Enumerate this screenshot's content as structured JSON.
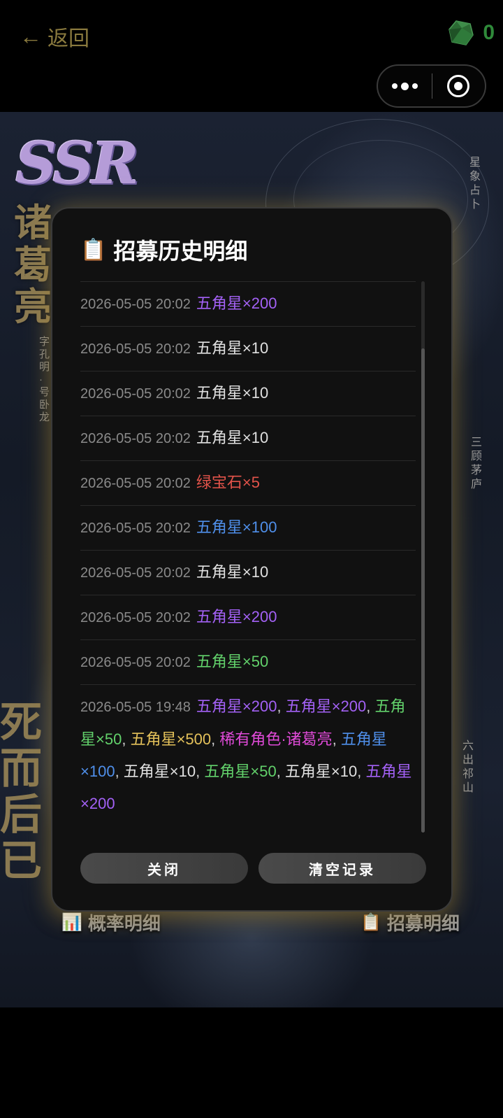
{
  "topbar": {
    "back_label": "返回",
    "gem_count": "0",
    "colors": {
      "back": "#8a7a3e",
      "gem": "#2f8a3a"
    }
  },
  "art": {
    "badge": "SSR",
    "hero_name": "诸葛亮",
    "hero_sub": "字孔明·号卧龙",
    "motto": "死而后已",
    "side_labels": [
      "星象占卜",
      "三顾茅庐",
      "六出祁山"
    ]
  },
  "modal": {
    "title": "招募历史明细",
    "title_icon": "clipboard-icon",
    "close_label": "关闭",
    "clear_label": "清空记录",
    "records": [
      {
        "time": "2026-05-05 20:02",
        "items": [
          {
            "text": "五角星×200",
            "color": "purple"
          }
        ]
      },
      {
        "time": "2026-05-05 20:02",
        "items": [
          {
            "text": "五角星×10",
            "color": "white"
          }
        ]
      },
      {
        "time": "2026-05-05 20:02",
        "items": [
          {
            "text": "五角星×10",
            "color": "white"
          }
        ]
      },
      {
        "time": "2026-05-05 20:02",
        "items": [
          {
            "text": "五角星×10",
            "color": "white"
          }
        ]
      },
      {
        "time": "2026-05-05 20:02",
        "items": [
          {
            "text": "绿宝石×5",
            "color": "red"
          }
        ]
      },
      {
        "time": "2026-05-05 20:02",
        "items": [
          {
            "text": "五角星×100",
            "color": "blue"
          }
        ]
      },
      {
        "time": "2026-05-05 20:02",
        "items": [
          {
            "text": "五角星×10",
            "color": "white"
          }
        ]
      },
      {
        "time": "2026-05-05 20:02",
        "items": [
          {
            "text": "五角星×200",
            "color": "purple"
          }
        ]
      },
      {
        "time": "2026-05-05 20:02",
        "items": [
          {
            "text": "五角星×50",
            "color": "green"
          }
        ]
      },
      {
        "time": "2026-05-05 19:48",
        "items": [
          {
            "text": "五角星×200",
            "color": "purple"
          },
          {
            "text": "五角星×200",
            "color": "purple"
          },
          {
            "text": "五角星×50",
            "color": "green"
          },
          {
            "text": "五角星×500",
            "color": "gold"
          },
          {
            "text": "稀有角色·诸葛亮",
            "color": "magenta"
          },
          {
            "text": "五角星×100",
            "color": "blue"
          },
          {
            "text": "五角星×10",
            "color": "white"
          },
          {
            "text": "五角星×50",
            "color": "green"
          },
          {
            "text": "五角星×10",
            "color": "white"
          },
          {
            "text": "五角星×200",
            "color": "purple"
          }
        ]
      }
    ],
    "item_separator": ", "
  },
  "bottom": {
    "rates_label": "概率明细",
    "rates_icon": "bar-chart-icon",
    "details_label": "招募明细",
    "details_icon": "clipboard-icon"
  }
}
